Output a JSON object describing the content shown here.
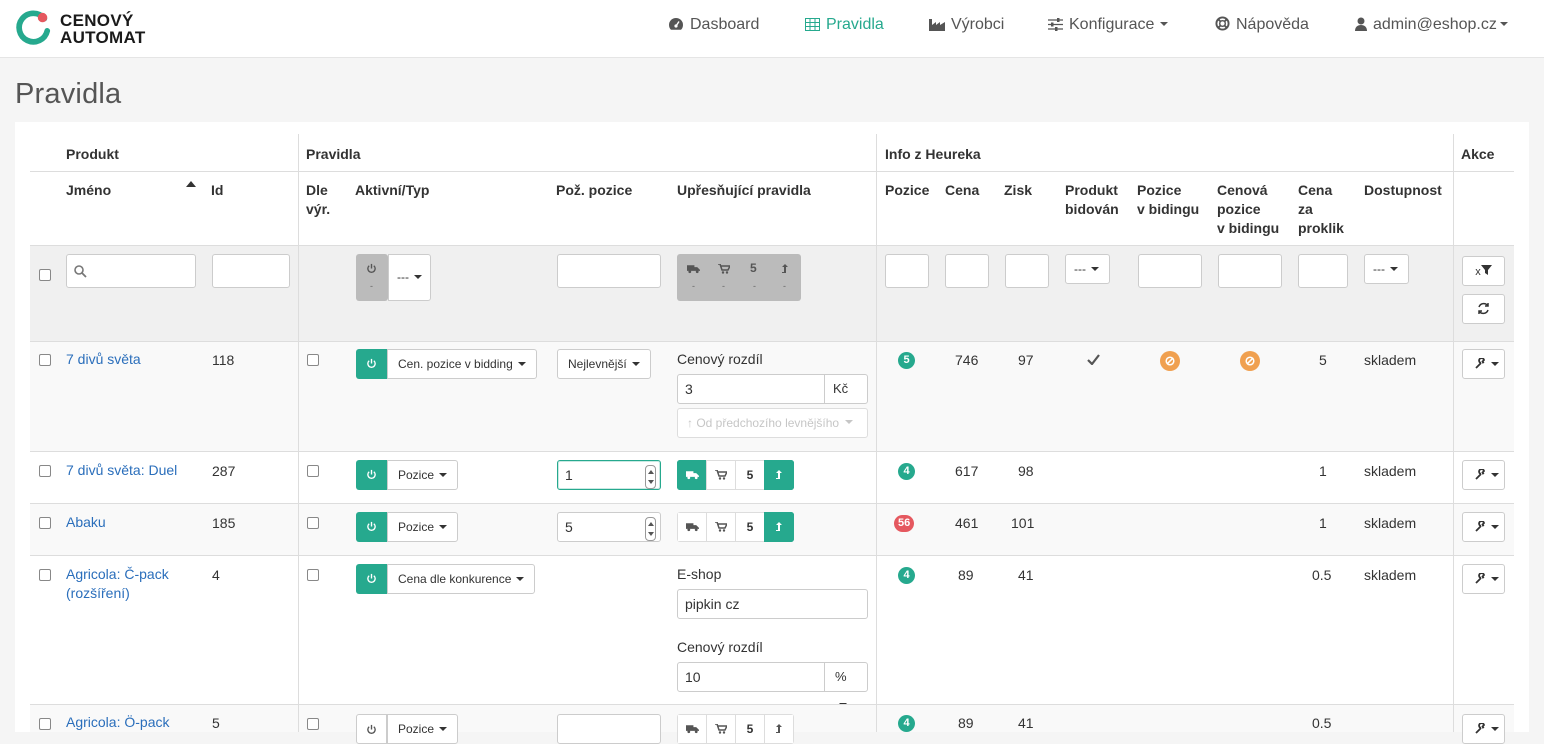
{
  "brand": {
    "line1": "CENOVÝ",
    "line2": "AUTOMAT",
    "accent": "#26a98e",
    "ring_red": "#e5585f"
  },
  "nav": {
    "dashboard": "Dasboard",
    "rules": "Pravidla",
    "manufacturers": "Výrobci",
    "config": "Konfigurace",
    "help": "Nápověda",
    "user": "admin@eshop.cz"
  },
  "page": {
    "title": "Pravidla"
  },
  "table": {
    "groups": {
      "product": "Produkt",
      "rules": "Pravidla",
      "heureka": "Info z Heureka",
      "actions": "Akce"
    },
    "columns": {
      "name": "Jméno",
      "id": "Id",
      "by_manufacturer": [
        "Dle",
        "výr."
      ],
      "active_type": "Aktivní/Typ",
      "req_position": "Pož. pozice",
      "refining": "Upřesňující pravidla",
      "position": "Pozice",
      "price": "Cena",
      "profit": "Zisk",
      "bidded": [
        "Produkt",
        "bidován"
      ],
      "bid_position": [
        "Pozice",
        "v bidingu"
      ],
      "price_bid_position": [
        "Cenová",
        "pozice",
        "v bidingu"
      ],
      "click_price": [
        "Cena",
        "za",
        "proklik"
      ],
      "availability": "Dostupnost"
    },
    "filters": {
      "type_placeholder": "---",
      "refine_seg": [
        "5"
      ],
      "refine_dots": "-",
      "bidded_select": "---",
      "availability_select": "---",
      "clear_label": "x"
    },
    "rows": [
      {
        "name": "7 divů světa",
        "id": "118",
        "type": "Cen. pozice v bidding",
        "req": "Nejlevnější",
        "refine_label": "Cenový rozdíl",
        "refine_value": "3",
        "refine_unit": "Kč",
        "refine_disabled": "Od předchozího levnějšího",
        "position": "5",
        "price": "746",
        "profit": "97",
        "click": "5",
        "availability": "skladem"
      },
      {
        "name": "7 divů světa: Duel",
        "id": "287",
        "type": "Pozice",
        "req_value": "1",
        "seg_num": "5",
        "position": "4",
        "price": "617",
        "profit": "98",
        "click": "1",
        "availability": "skladem"
      },
      {
        "name": "Abaku",
        "id": "185",
        "type": "Pozice",
        "req_value": "5",
        "seg_num": "5",
        "position": "56",
        "price": "461",
        "profit": "101",
        "click": "1",
        "availability": "skladem"
      },
      {
        "name_l1": "Agricola: Č-pack",
        "name_l2": "(rozšíření)",
        "id": "4",
        "type": "Cena dle konkurence",
        "eshop_label": "E-shop",
        "eshop_value": "pipkin cz",
        "refine_label": "Cenový rozdíl",
        "refine_value": "10",
        "refine_unit": "%",
        "position": "4",
        "price": "89",
        "profit": "41",
        "click": "0.5",
        "availability": "skladem"
      },
      {
        "name": "Agricola: Ö-pack",
        "id": "5",
        "type": "Pozice",
        "seg_num": "5",
        "position": "4",
        "price": "89",
        "profit": "41",
        "click": "0.5"
      }
    ]
  }
}
